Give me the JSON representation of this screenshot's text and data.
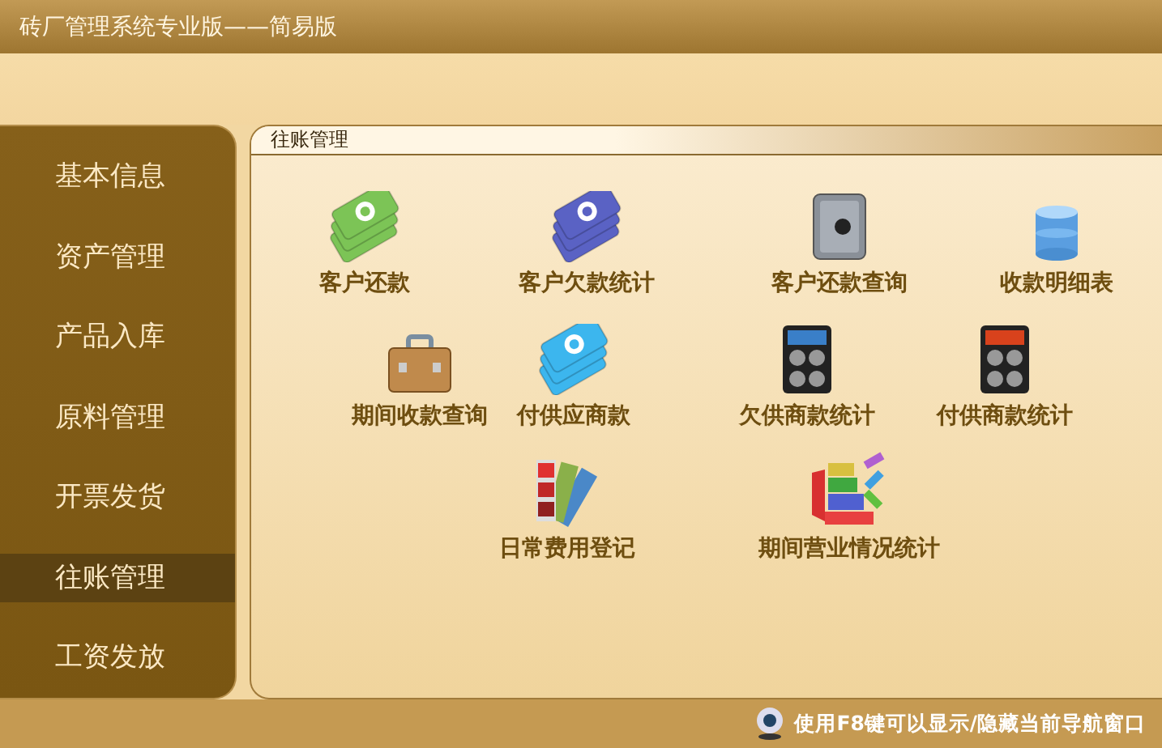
{
  "window": {
    "title": "砖厂管理系统专业版——简易版"
  },
  "sidebar": {
    "items": [
      {
        "label": "基本信息",
        "selected": false
      },
      {
        "label": "资产管理",
        "selected": false
      },
      {
        "label": "产品入库",
        "selected": false
      },
      {
        "label": "原料管理",
        "selected": false
      },
      {
        "label": "开票发货",
        "selected": false
      },
      {
        "label": "往账管理",
        "selected": true
      },
      {
        "label": "工资发放",
        "selected": false
      }
    ]
  },
  "panel": {
    "title": "往账管理",
    "shortcuts": [
      {
        "label": "客户还款",
        "kind": "cash",
        "color": "#7cc456"
      },
      {
        "label": "客户欠款统计",
        "kind": "cash",
        "color": "#5a62c4"
      },
      {
        "label": "客户还款查询",
        "kind": "safe"
      },
      {
        "label": "收款明细表",
        "kind": "database"
      },
      {
        "label": "期间收款查询",
        "kind": "briefcase"
      },
      {
        "label": "付供应商款",
        "kind": "cash",
        "color": "#3cb6ee"
      },
      {
        "label": "欠供商款统计",
        "kind": "calculator",
        "color": "#3a7fc8"
      },
      {
        "label": "付供商款统计",
        "kind": "calculator",
        "color": "#d8421c"
      },
      {
        "label": "日常费用登记",
        "kind": "swatches"
      },
      {
        "label": "期间营业情况统计",
        "kind": "blocks"
      }
    ]
  },
  "status_bar": {
    "hint": "使用F8键可以显示/隐藏当前导航窗口"
  }
}
